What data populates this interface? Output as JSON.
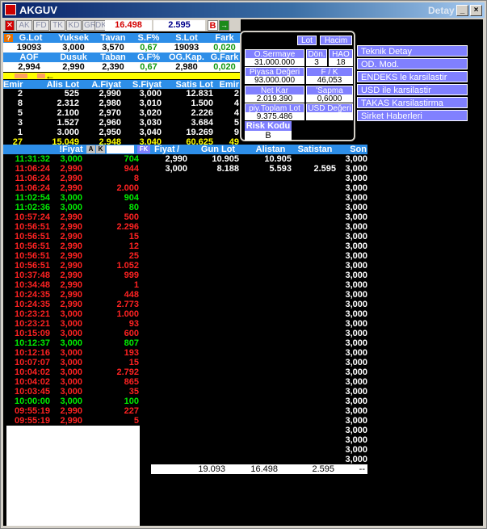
{
  "window": {
    "title": "AKGUV",
    "detail_label": "Detay",
    "min": "_",
    "max": "□",
    "close": "×"
  },
  "toolbar": {
    "buttons": [
      "AK",
      "FD",
      "TK",
      "KD",
      "GR",
      "DK"
    ],
    "red_value": "16.498",
    "blue_value": "2.595",
    "b_label": "B",
    "arrow_label": "→"
  },
  "summary1": {
    "headers": [
      "G.Lot",
      "Yuksek",
      "Tavan",
      "S.F%",
      "S.Lot",
      "Fark"
    ],
    "values": [
      "19093",
      "3,000",
      "3,570",
      "0,67",
      "19093",
      "0,020"
    ]
  },
  "summary2": {
    "headers": [
      "AOF",
      "Dusuk",
      "Taban",
      "G.F%",
      "OG.Kap.",
      "G.Fark"
    ],
    "values": [
      "2,994",
      "2,990",
      "2,390",
      "0,67",
      "2,980",
      "0,020"
    ]
  },
  "depth": {
    "headers": [
      "Emir",
      "Alis Lot",
      "A.Fiyat",
      "S.Fiyat",
      "Satis Lot",
      "Emir"
    ],
    "rows": [
      [
        "2",
        "525",
        "2,990",
        "3,000",
        "12.831",
        "2"
      ],
      [
        "8",
        "2.312",
        "2,980",
        "3,010",
        "1.500",
        "4"
      ],
      [
        "5",
        "2.100",
        "2,970",
        "3,020",
        "2.226",
        "4"
      ],
      [
        "3",
        "1.527",
        "2,960",
        "3,030",
        "3.684",
        "5"
      ],
      [
        "1",
        "3.000",
        "2,950",
        "3,040",
        "19.269",
        "9"
      ]
    ],
    "total": [
      "27",
      "15.049",
      "2,948",
      "3,040",
      "60.625",
      "49"
    ]
  },
  "fundamentals": {
    "lot_btn": "Lot",
    "hacim_btn": "Hacim",
    "osermaye_label": "O.Sermaye",
    "osermaye_value": "31.000.000",
    "don_label": "Dön.",
    "don_value": "3",
    "hao_label": "HAO",
    "hao_value": "18",
    "piyasa_label": "Piyasa Değeri",
    "piyasa_value": "93.000.000",
    "fk_label": "F / K",
    "fk_value": "46,053",
    "netkar_label": "Net Kar",
    "netkar_value": "2.019.390",
    "sapma_label": "'Sapma",
    "sapma_value": "0,6000",
    "piytoplam_label": "piy.Toplam Lot",
    "piytoplam_value": "9.375.486",
    "usd_label": "USD Değeri",
    "usd_value": "",
    "risk_label": "Risk Kodu",
    "risk_value": "B"
  },
  "menu": [
    "Teknik Detay",
    "OD. Mod.",
    "ENDEKS le karsilastir",
    "USD ile karsilastir",
    "TAKAS Karsilastirma",
    "Sirket Haberleri"
  ],
  "trades_header": {
    "fiyat": "!Fiyat",
    "a": "A",
    "k": "K",
    "fk": "FK"
  },
  "trades": [
    {
      "time": "11:31:32",
      "price": "3,000",
      "lot": "704",
      "dir": "up"
    },
    {
      "time": "11:06:24",
      "price": "2,990",
      "lot": "944",
      "dir": "dn"
    },
    {
      "time": "11:06:24",
      "price": "2,990",
      "lot": "8",
      "dir": "dn"
    },
    {
      "time": "11:06:24",
      "price": "2,990",
      "lot": "2.000",
      "dir": "dn"
    },
    {
      "time": "11:02:54",
      "price": "3,000",
      "lot": "904",
      "dir": "up"
    },
    {
      "time": "11:02:36",
      "price": "3,000",
      "lot": "80",
      "dir": "up"
    },
    {
      "time": "10:57:24",
      "price": "2,990",
      "lot": "500",
      "dir": "dn"
    },
    {
      "time": "10:56:51",
      "price": "2,990",
      "lot": "2.296",
      "dir": "dn"
    },
    {
      "time": "10:56:51",
      "price": "2,990",
      "lot": "15",
      "dir": "dn"
    },
    {
      "time": "10:56:51",
      "price": "2,990",
      "lot": "12",
      "dir": "dn"
    },
    {
      "time": "10:56:51",
      "price": "2,990",
      "lot": "25",
      "dir": "dn"
    },
    {
      "time": "10:56:51",
      "price": "2,990",
      "lot": "1.052",
      "dir": "dn"
    },
    {
      "time": "10:37:48",
      "price": "2,990",
      "lot": "999",
      "dir": "dn"
    },
    {
      "time": "10:34:48",
      "price": "2,990",
      "lot": "1",
      "dir": "dn"
    },
    {
      "time": "10:24:35",
      "price": "2,990",
      "lot": "448",
      "dir": "dn"
    },
    {
      "time": "10:24:35",
      "price": "2,990",
      "lot": "2.773",
      "dir": "dn"
    },
    {
      "time": "10:23:21",
      "price": "3,000",
      "lot": "1.000",
      "dir": "dn"
    },
    {
      "time": "10:23:21",
      "price": "3,000",
      "lot": "93",
      "dir": "dn"
    },
    {
      "time": "10:15:09",
      "price": "3,000",
      "lot": "600",
      "dir": "dn"
    },
    {
      "time": "10:12:37",
      "price": "3,000",
      "lot": "807",
      "dir": "up"
    },
    {
      "time": "10:12:16",
      "price": "3,000",
      "lot": "193",
      "dir": "dn"
    },
    {
      "time": "10:07:07",
      "price": "3,000",
      "lot": "15",
      "dir": "dn"
    },
    {
      "time": "10:04:02",
      "price": "3,000",
      "lot": "2.792",
      "dir": "dn"
    },
    {
      "time": "10:04:02",
      "price": "3,000",
      "lot": "865",
      "dir": "dn"
    },
    {
      "time": "10:03:45",
      "price": "3,000",
      "lot": "35",
      "dir": "dn"
    },
    {
      "time": "10:00:00",
      "price": "3,000",
      "lot": "100",
      "dir": "up"
    },
    {
      "time": "09:55:19",
      "price": "2,990",
      "lot": "227",
      "dir": "dn"
    },
    {
      "time": "09:55:19",
      "price": "2,990",
      "lot": "5",
      "dir": "dn"
    }
  ],
  "price_table": {
    "headers": [
      "Fiyat",
      "Gun Lot",
      "Alistan",
      "Satistan",
      "Son"
    ],
    "rows": [
      [
        "2,990",
        "10.905",
        "10.905",
        "",
        "3,000"
      ],
      [
        "3,000",
        "8.188",
        "5.593",
        "2.595",
        "3,000"
      ]
    ],
    "son_values": [
      "3,000",
      "3,000",
      "3,000",
      "3,000",
      "3,000",
      "3,000",
      "3,000",
      "3,000",
      "3,000",
      "3,000",
      "3,000",
      "3,000",
      "3,000",
      "3,000",
      "3,000",
      "3,000",
      "3,000",
      "3,000",
      "3,000",
      "3,000",
      "3,000",
      "3,000",
      "3,000",
      "3,000",
      "3,000",
      "3,000",
      "3,000",
      "3,000",
      "3,000",
      "3,000",
      "3,000",
      "3,000"
    ],
    "totals": [
      "19.093",
      "16.498",
      "2.595",
      "--"
    ]
  }
}
